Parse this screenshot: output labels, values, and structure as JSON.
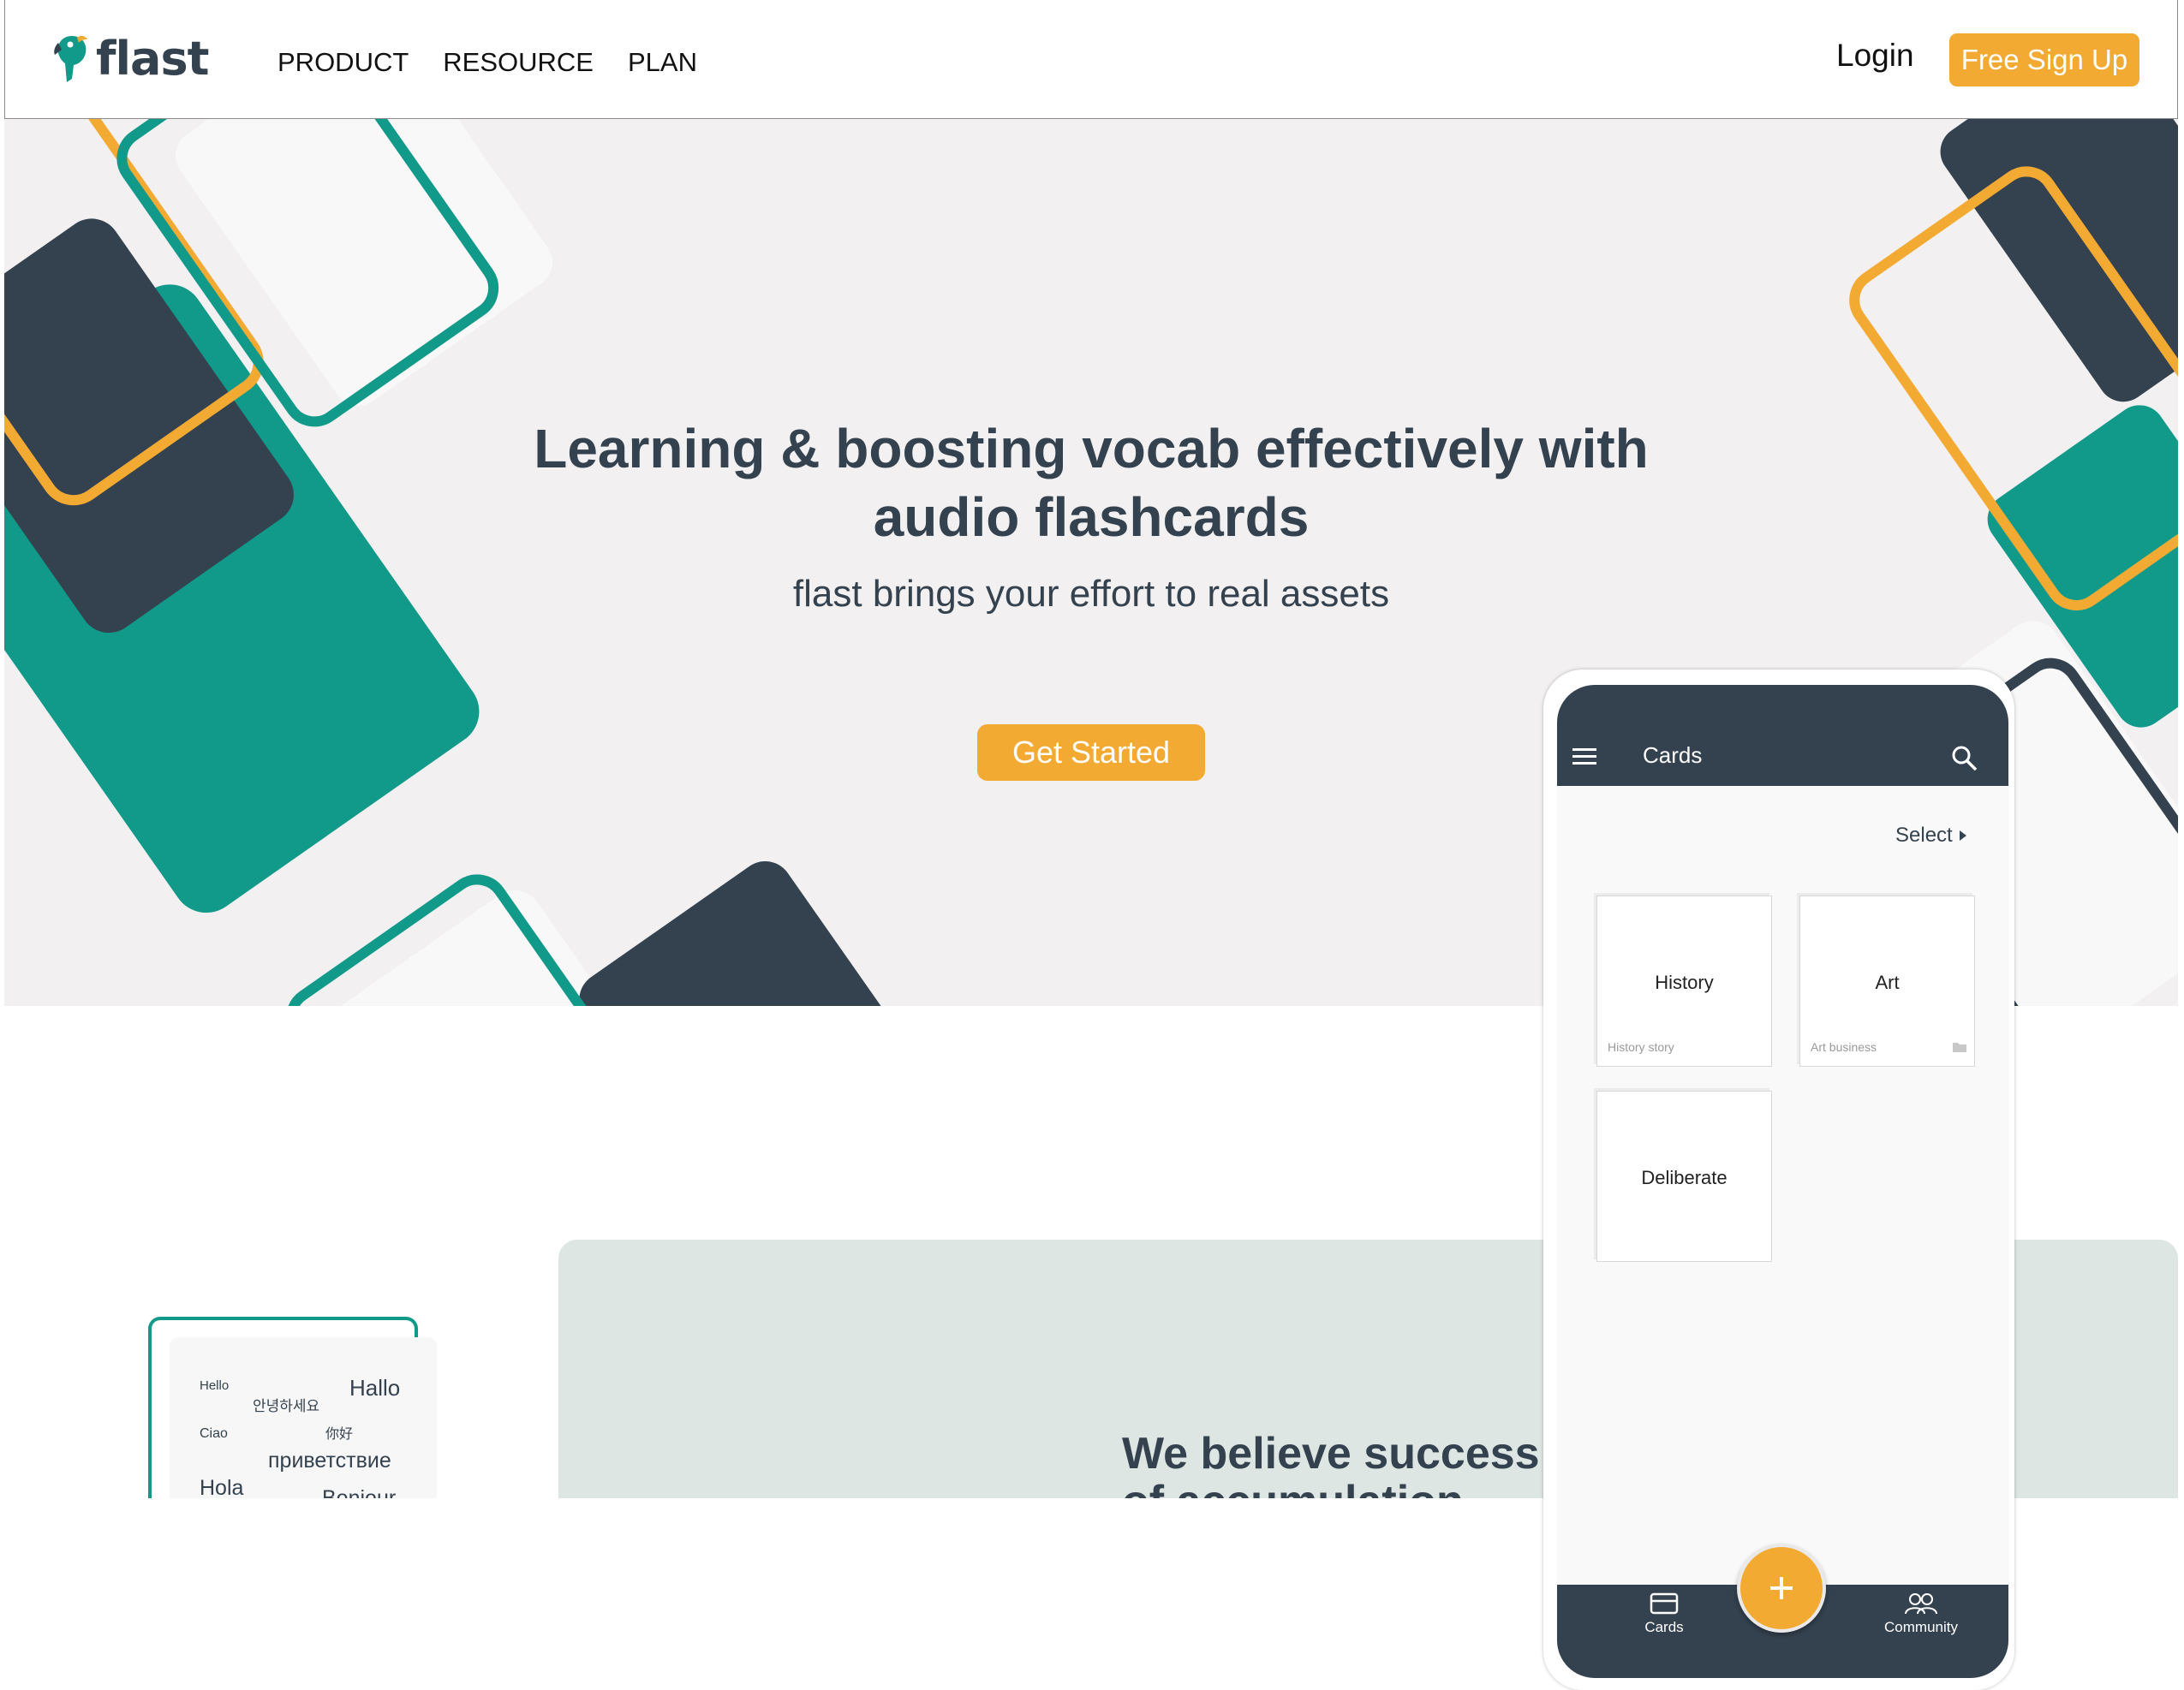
{
  "brand": {
    "name": "flast",
    "accent": "#f3aa33",
    "dark": "#34424f",
    "teal": "#11998a"
  },
  "nav": {
    "items": [
      {
        "label": "PRODUCT"
      },
      {
        "label": "RESOURCE"
      },
      {
        "label": "PLAN"
      }
    ],
    "login": "Login",
    "signup": "Free Sign Up"
  },
  "hero": {
    "headline_line1": "Learning & boosting vocab effectively with",
    "headline_line2": "audio flashcards",
    "tagline": "flast brings your effort to real assets",
    "cta": "Get Started"
  },
  "section": {
    "belief_line1": "We believe success i",
    "belief_line2": "of accumulation"
  },
  "greetings": [
    "Hello",
    "안녕하세요",
    "Hallo",
    "Ciao",
    "你好",
    "приветствие",
    "Hola",
    "Bonjour"
  ],
  "phone": {
    "appbar_title": "Cards",
    "select_label": "Select",
    "cards": [
      {
        "title": "History",
        "subtitle": "History story"
      },
      {
        "title": "Art",
        "subtitle": "Art business"
      },
      {
        "title": "Deliberate",
        "subtitle": ""
      }
    ],
    "tabs": [
      {
        "label": "Cards",
        "icon": "cards-icon"
      },
      {
        "label": "Community",
        "icon": "community-icon"
      }
    ],
    "fab_icon": "plus-icon"
  }
}
